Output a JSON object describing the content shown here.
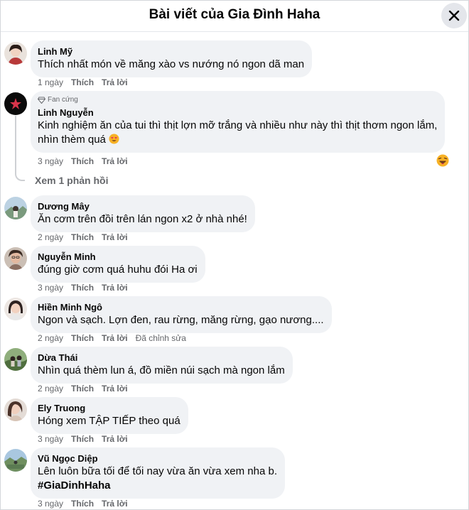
{
  "header": {
    "title": "Bài viết của Gia Đình Haha"
  },
  "view_replies": "Xem 1 phản hồi",
  "actions": {
    "like": "Thích",
    "reply": "Trả lời"
  },
  "comments": [
    {
      "author": "Linh Mỹ",
      "text": "Thích nhất món về măng xào vs nướng nó ngon dã man",
      "time": "1 ngày"
    },
    {
      "badge": "Fan cứng",
      "author": "Linh Nguyễn",
      "line1": "Kinh nghiệm ăn của tui thì thịt lợn mỡ trắng và nhiều như này thì thịt thơm ngon lắm,",
      "line2": "nhìn thèm quá",
      "time": "3 ngày"
    },
    {
      "author": "Dương Mây",
      "text": "Ăn cơm trên đồi trên lán ngon x2 ở nhà nhé!",
      "time": "2 ngày"
    },
    {
      "author": "Nguyễn Minh",
      "text": "đúng giờ cơm quá huhu đói Ha ơi",
      "time": "3 ngày"
    },
    {
      "author": "Hiền Minh Ngô",
      "text": "Ngon và sạch. Lợn đen, rau rừng, măng rừng, gạo nương....",
      "time": "2 ngày",
      "edited": "Đã chỉnh sửa"
    },
    {
      "author": "Dừa Thái",
      "text": "Nhìn quá thèm lun á, đồ miền núi sạch mà ngon lắm",
      "time": "2 ngày"
    },
    {
      "author": "Ely Truong",
      "text": "Hóng xem TẬP TIẾP theo quá",
      "time": "3 ngày"
    },
    {
      "author": "Vũ Ngọc Diệp",
      "line1": "Lên luôn bữa tối để tối nay vừa ăn vừa xem nha b.",
      "hashtag": "#GiaDinhHaha",
      "time": "3 ngày"
    }
  ],
  "colors": {
    "bubble": "#f0f2f5",
    "secondary_text": "#65676b",
    "close_bg": "#e4e6eb"
  }
}
